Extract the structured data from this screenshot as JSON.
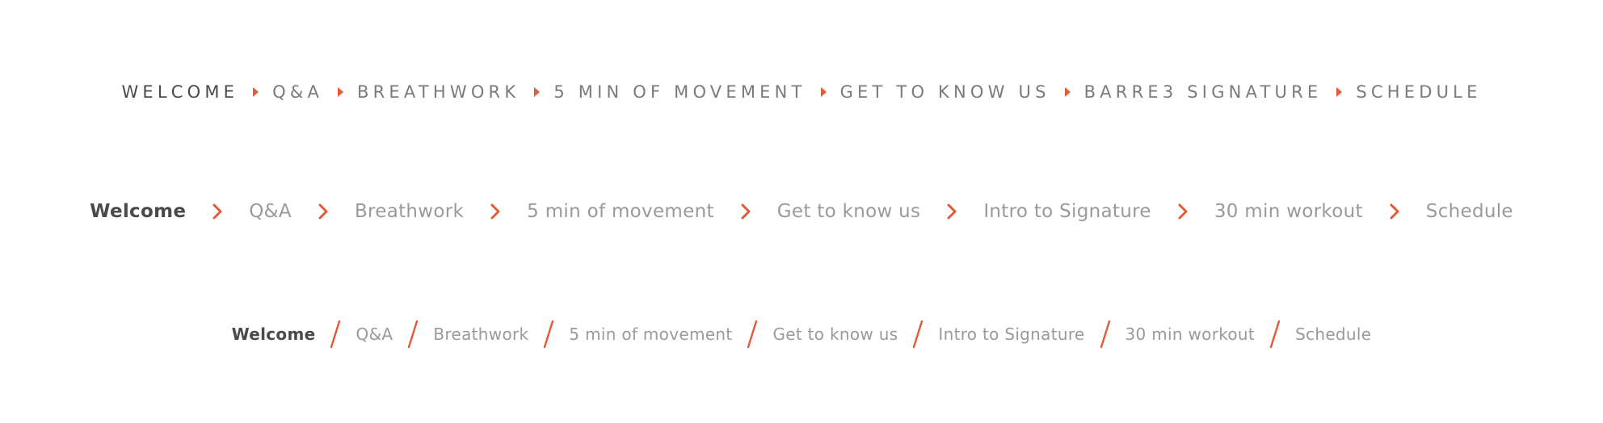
{
  "colors": {
    "accent": "#e25a37",
    "active_text": "#4a4a4a",
    "inactive_text": "#9a9a9a"
  },
  "breadcrumb_uppercase": {
    "separator_icon": "caret-right-icon",
    "items": [
      "WELCOME",
      "Q&A",
      "BREATHWORK",
      "5 MIN OF MOVEMENT",
      "GET TO KNOW US",
      "BARRE3 SIGNATURE",
      "SCHEDULE"
    ]
  },
  "breadcrumb_chevron": {
    "separator_icon": "chevron-right-icon",
    "items": [
      "Welcome",
      "Q&A",
      "Breathwork",
      "5 min of movement",
      "Get to know us",
      "Intro to Signature",
      "30 min workout",
      "Schedule"
    ]
  },
  "breadcrumb_slash": {
    "separator_icon": "slash-icon",
    "items": [
      "Welcome",
      "Q&A",
      "Breathwork",
      "5 min of movement",
      "Get to know us",
      "Intro to Signature",
      "30 min workout",
      "Schedule"
    ]
  }
}
